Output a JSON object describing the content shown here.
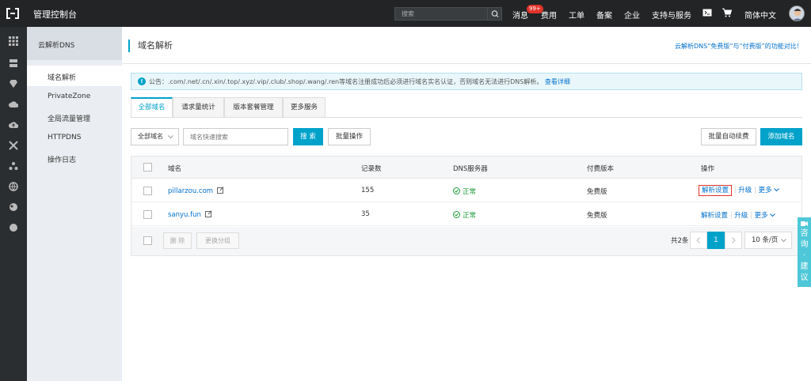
{
  "topbar": {
    "title": "管理控制台",
    "search_placeholder": "搜索",
    "messages": "消息",
    "badge": "99+",
    "nav": [
      "费用",
      "工单",
      "备案",
      "企业",
      "支持与服务"
    ],
    "lang": "简体中文"
  },
  "rail_icons": [
    "grid-icon",
    "server-icon",
    "gem-icon",
    "cloud-icon",
    "cloud-upload-icon",
    "network-icon",
    "cluster-icon",
    "globe-icon",
    "cdn-icon",
    "circle-icon"
  ],
  "sidebar": {
    "header": "云解析DNS",
    "items": [
      {
        "label": "域名解析"
      },
      {
        "label": "PrivateZone"
      },
      {
        "label": "全局流量管理"
      },
      {
        "label": "HTTPDNS"
      },
      {
        "label": "操作日志"
      }
    ]
  },
  "main": {
    "title": "域名解析",
    "compare_link": "云解析DNS“免费版”与“付费版”的功能对比!",
    "notice": {
      "prefix": "公告：.com/.net/.cn/.xin/.top/.xyz/.vip/.club/.shop/.wang/.ren等域名注册成功后必须进行域名实名认证，否则域名无法进行DNS解析。",
      "more": "查看详细"
    },
    "tabs": [
      "全部域名",
      "请求量统计",
      "版本套餐管理",
      "更多服务"
    ],
    "filter": {
      "select": "全部域名",
      "search_placeholder": "域名快速搜索",
      "search_btn": "搜 索",
      "batch_btn": "批量操作",
      "auto_renew_btn": "批量自动续费",
      "add_btn": "添加域名"
    },
    "table": {
      "headers": [
        "域名",
        "记录数",
        "DNS服务器",
        "付费版本",
        "操作"
      ],
      "rows": [
        {
          "domain": "pillarzou.com",
          "records": "155",
          "dns": "正常",
          "version": "免费版",
          "action": "解析设置",
          "upgrade": "升级",
          "more": "更多"
        },
        {
          "domain": "sanyu.fun",
          "records": "35",
          "dns": "正常",
          "version": "免费版",
          "action": "解析设置",
          "upgrade": "升级",
          "more": "更多"
        }
      ],
      "footer": {
        "delete_btn": "删 除",
        "change_group_btn": "更换分组",
        "total": "共2条",
        "current_page": "1",
        "page_size": "10 条/页"
      }
    }
  },
  "float": {
    "label": "咨询·建议"
  },
  "colors": {
    "accent": "#00a2ca",
    "topbar": "#222426",
    "link": "#0070cc",
    "ok": "#1e9e3a",
    "highlight": "#e2332a"
  }
}
